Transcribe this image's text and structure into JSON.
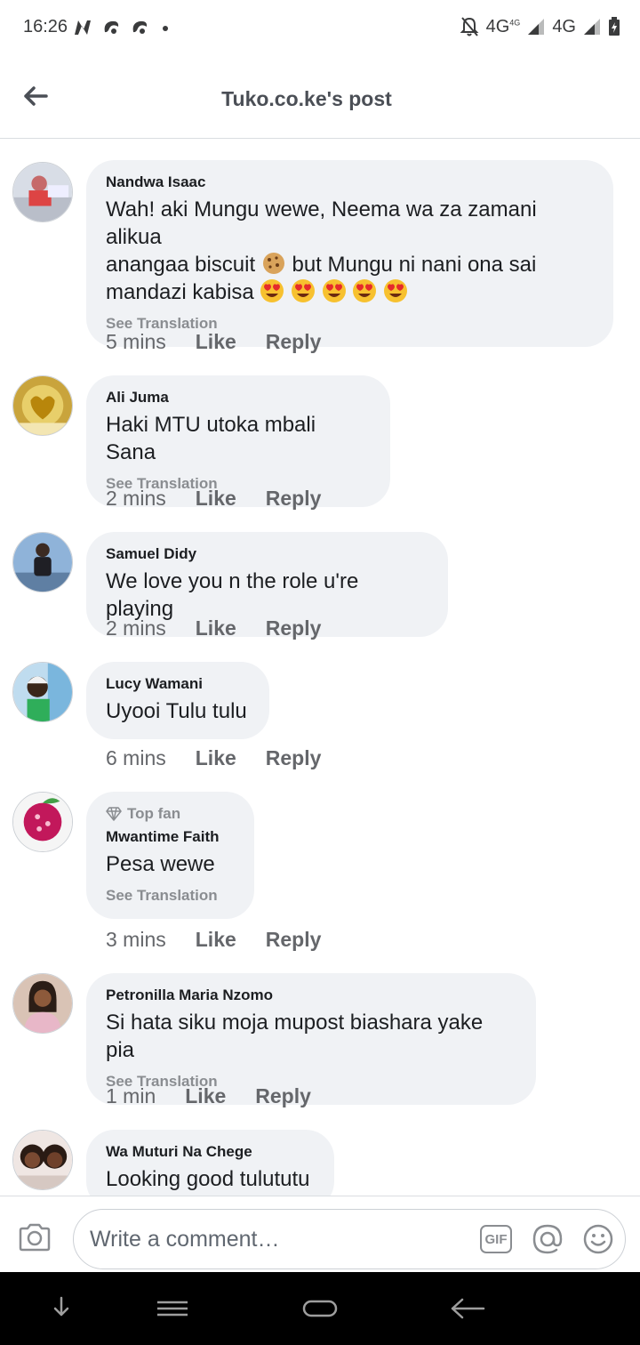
{
  "status_bar": {
    "time": "16:26",
    "net1": "4G",
    "net1_sup": "4G",
    "net2": "4G"
  },
  "header": {
    "title": "Tuko.co.ke's post"
  },
  "comments": [
    {
      "author": "Nandwa Isaac",
      "text_lines": [
        "Wah! aki Mungu wewe, Neema wa za zamani alikua",
        "anangaa biscuit",
        "but Mungu ni nani ona sai",
        "mandazi kabisa"
      ],
      "see_translation": "See Translation",
      "time": "5 mins",
      "like": "Like",
      "reply": "Reply"
    },
    {
      "author": "Ali Juma",
      "text": "Haki MTU utoka mbali Sana",
      "see_translation": "See Translation",
      "time": "2 mins",
      "like": "Like",
      "reply": "Reply"
    },
    {
      "author": "Samuel Didy",
      "text": "We love you n the role u're playing",
      "time": "2 mins",
      "like": "Like",
      "reply": "Reply"
    },
    {
      "author": "Lucy Wamani",
      "text": "Uyooi Tulu tulu",
      "time": "6 mins",
      "like": "Like",
      "reply": "Reply"
    },
    {
      "badge": "Top fan",
      "author": "Mwantime Faith",
      "text": "Pesa wewe",
      "see_translation": "See Translation",
      "time": "3 mins",
      "like": "Like",
      "reply": "Reply"
    },
    {
      "author": "Petronilla Maria Nzomo",
      "text": "Si hata siku moja mupost biashara yake pia",
      "see_translation": "See Translation",
      "time": "1 min",
      "like": "Like",
      "reply": "Reply"
    },
    {
      "author": "Wa Muturi Na Chege",
      "text": "Looking good tulututu"
    }
  ],
  "composer": {
    "placeholder": "Write a comment…",
    "gif_label": "GIF"
  },
  "colors": {
    "bubble": "#f0f2f5",
    "meta_gray": "#65676b",
    "translation_gray": "#8a8d91",
    "text": "#1c1e21"
  }
}
